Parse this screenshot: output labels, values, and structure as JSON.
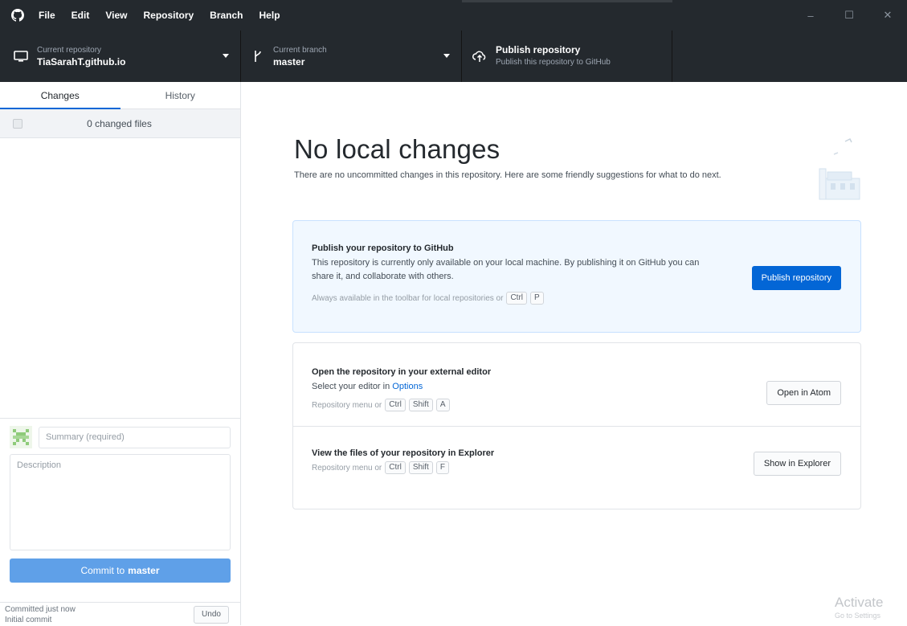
{
  "menu": {
    "items": [
      "File",
      "Edit",
      "View",
      "Repository",
      "Branch",
      "Help"
    ]
  },
  "window_controls": {
    "minimize": "–",
    "maximize": "☐",
    "close": "✕"
  },
  "toolbar": {
    "repo_label": "Current repository",
    "repo_value": "TiaSarahT.github.io",
    "branch_label": "Current branch",
    "branch_value": "master",
    "publish_title": "Publish repository",
    "publish_desc": "Publish this repository to GitHub"
  },
  "sidebar": {
    "tabs": [
      "Changes",
      "History"
    ],
    "changed_files": "0 changed files",
    "summary_placeholder": "Summary (required)",
    "description_placeholder": "Description",
    "commit_prefix": "Commit to",
    "commit_branch": "master",
    "last_commit_time": "Committed just now",
    "last_commit_msg": "Initial commit",
    "undo_label": "Undo"
  },
  "main": {
    "heading": "No local changes",
    "subtext": "There are no uncommitted changes in this repository. Here are some friendly suggestions for what to do next.",
    "publish_card": {
      "title": "Publish your repository to GitHub",
      "desc": "This repository is currently only available on your local machine. By publishing it on GitHub you can share it, and collaborate with others.",
      "hint": "Always available in the toolbar for local repositories or",
      "keys": [
        "Ctrl",
        "P"
      ],
      "button": "Publish repository"
    },
    "editor_card": {
      "title": "Open the repository in your external editor",
      "desc_prefix": "Select your editor in",
      "desc_link": "Options",
      "hint": "Repository menu or",
      "keys": [
        "Ctrl",
        "Shift",
        "A"
      ],
      "button": "Open in Atom"
    },
    "explorer_card": {
      "title": "View the files of your repository in Explorer",
      "hint": "Repository menu or",
      "keys": [
        "Ctrl",
        "Shift",
        "F"
      ],
      "button": "Show in Explorer"
    }
  },
  "watermark": {
    "title": "Activate",
    "sub": "Go to Settings"
  },
  "colors": {
    "titlebar": "#24292e",
    "primary_button": "#0366d6",
    "commit_button": "#5fa0e8",
    "publish_card_bg": "#f1f8ff"
  }
}
